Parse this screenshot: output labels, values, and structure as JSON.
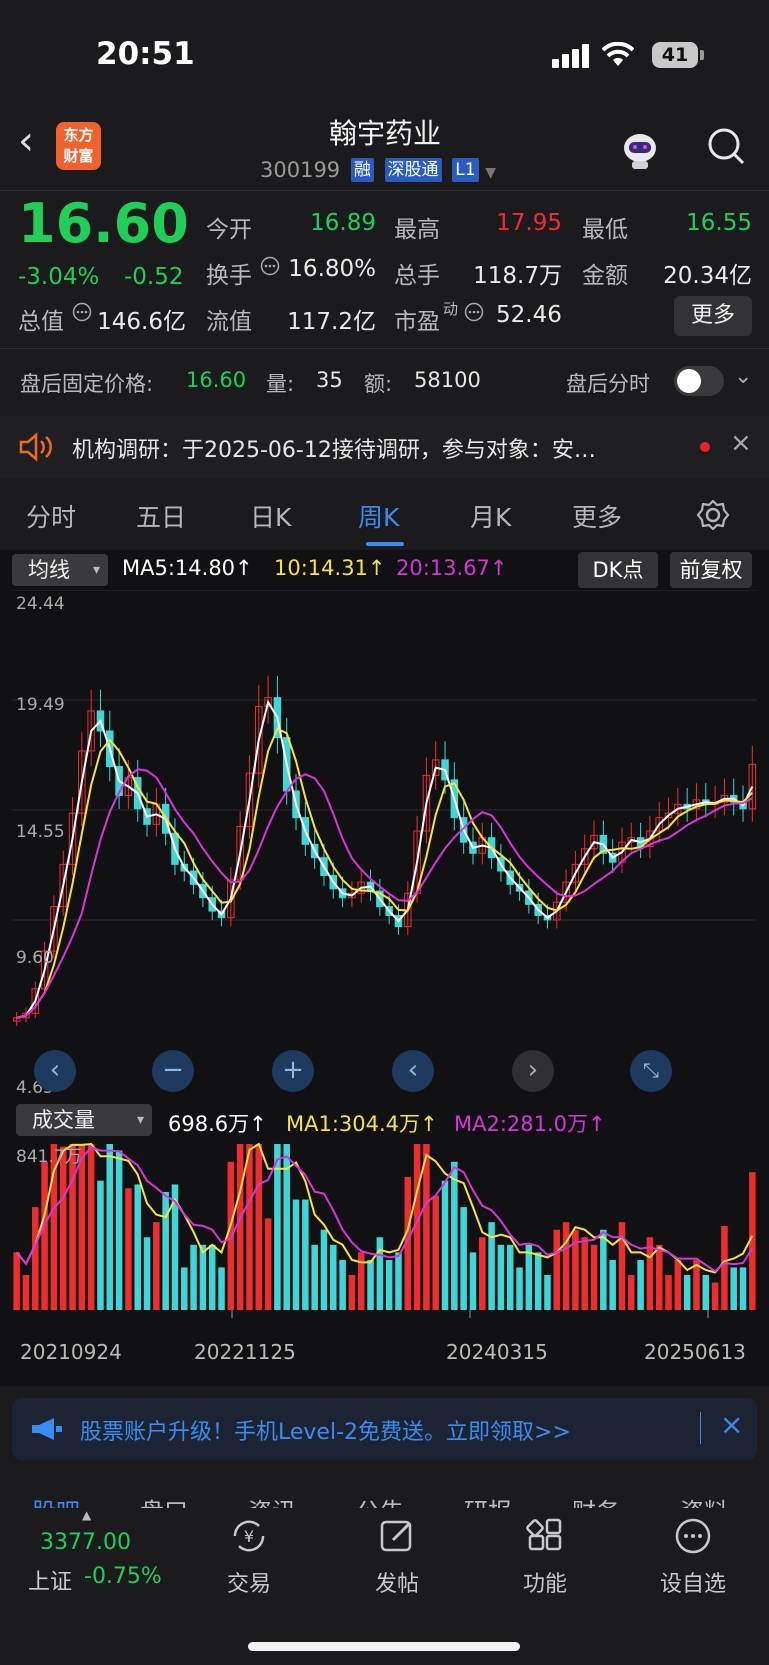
{
  "status_bar": {
    "time": "20:51",
    "battery": "41"
  },
  "nav": {
    "logo_line1": "东方",
    "logo_line2": "财富",
    "stock_name": "翰宇药业",
    "stock_code": "300199",
    "tags": [
      "融",
      "深股通",
      "L1"
    ]
  },
  "quote": {
    "price": "16.60",
    "change_pct": "-3.04%",
    "change": "-0.52",
    "open_label": "今开",
    "open": "16.89",
    "high_label": "最高",
    "high": "17.95",
    "low_label": "最低",
    "low": "16.55",
    "turnover_label": "换手",
    "turnover": "16.80%",
    "volume_label": "总手",
    "volume": "118.7万",
    "amount_label": "金额",
    "amount": "20.34亿",
    "mktcap_label": "总值",
    "mktcap": "146.6亿",
    "float_label": "流值",
    "float_cap": "117.2亿",
    "pe_label": "市盈",
    "pe_sup": "动",
    "pe": "52.46",
    "more_label": "更多"
  },
  "after_hours": {
    "label": "盘后固定价格:",
    "price": "16.60",
    "qty_label": "量:",
    "qty": "35",
    "amt_label": "额:",
    "amt": "58100",
    "timeshare_label": "盘后分时"
  },
  "research": {
    "text": "机构调研：于2025-06-12接待调研，参与对象：安…"
  },
  "period_tabs": [
    "分时",
    "五日",
    "日K",
    "周K",
    "月K",
    "更多"
  ],
  "active_tab": "周K",
  "kline_header": {
    "select_label": "均线",
    "ma5": "MA5:14.80↑",
    "ma10": "10:14.31↑",
    "ma20": "20:13.67↑",
    "dk_label": "DK点",
    "fq_label": "前复权"
  },
  "price_axis": [
    "24.44",
    "19.49",
    "14.55",
    "9.60",
    "4.65"
  ],
  "volume_header": {
    "select_label": "成交量",
    "vol": "698.6万↑",
    "ma1": "MA1:304.4万↑",
    "ma2": "MA2:281.0万↑"
  },
  "volume_axis_max": "841.7万",
  "date_axis": [
    "20210924",
    "20221125",
    "20240315",
    "20250613"
  ],
  "colors": {
    "up": "#ee2e2e",
    "down": "#1fcf58",
    "ma5": "#ffffff",
    "ma10": "#f5e342",
    "ma20": "#d536d8",
    "accent": "#3b8cf0"
  },
  "chart_data": {
    "type": "candlestick",
    "period": "weekly",
    "x_ticks": [
      "20210924",
      "20221125",
      "20240315",
      "20250613"
    ],
    "ylim": [
      4.65,
      24.44
    ],
    "close_series": [
      5.2,
      5.4,
      6.5,
      8.2,
      10.2,
      12.1,
      14.4,
      17.2,
      19.0,
      18.1,
      16.5,
      15.2,
      16.0,
      14.6,
      13.9,
      14.8,
      13.5,
      12.1,
      11.8,
      11.2,
      10.6,
      10.0,
      9.7,
      11.4,
      13.8,
      16.2,
      19.2,
      19.6,
      17.8,
      15.4,
      14.2,
      13.0,
      12.4,
      11.6,
      11.0,
      10.6,
      10.8,
      11.3,
      10.9,
      10.2,
      9.8,
      9.3,
      10.8,
      13.6,
      16.1,
      16.8,
      15.9,
      14.2,
      13.1,
      12.6,
      13.3,
      12.4,
      11.8,
      11.2,
      10.9,
      10.3,
      9.8,
      9.6,
      10.4,
      11.3,
      12.1,
      12.8,
      13.4,
      12.6,
      12.2,
      13.1,
      13.3,
      12.9,
      13.6,
      14.2,
      14.4,
      14.8,
      14.6,
      15.0,
      14.8,
      14.9,
      15.2,
      14.9,
      14.6,
      16.6
    ],
    "ma5_last": 14.8,
    "ma10_last": 14.31,
    "ma20_last": 13.67,
    "volume_max_label": "841.7万",
    "volume_last": "698.6万",
    "vol_ma1": "304.4万",
    "vol_ma2": "281.0万"
  },
  "controls": [
    "zoom-out",
    "zoom-in",
    "prev",
    "next",
    "fullscreen"
  ],
  "banner": {
    "text": "股票账户升级！手机Level-2免费送。立即领取>>"
  },
  "bottom_tabs": [
    "股吧",
    "盘口",
    "资讯",
    "公告",
    "研报",
    "财务",
    "资料"
  ],
  "bottom_bar": {
    "index_value": "3377.00",
    "index_name": "上证",
    "index_change": "-0.75%",
    "items": [
      "交易",
      "发帖",
      "功能",
      "设自选"
    ]
  }
}
